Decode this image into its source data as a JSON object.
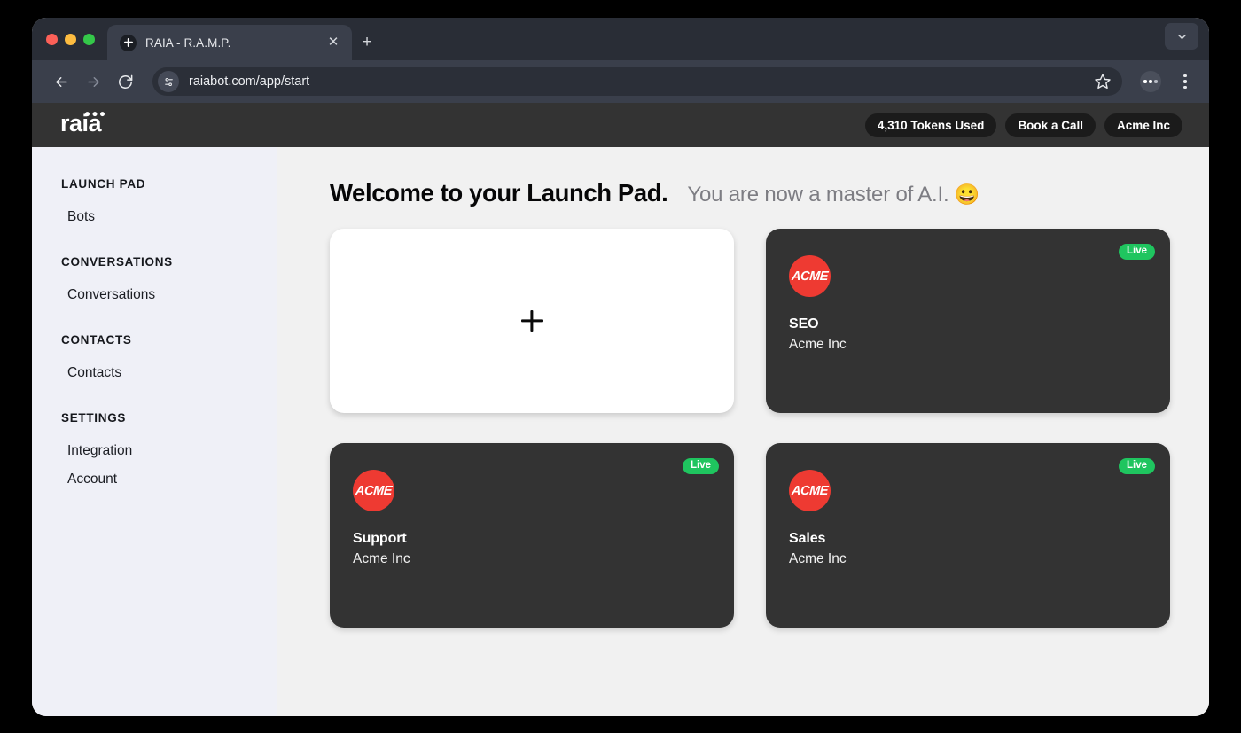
{
  "browser": {
    "tab": {
      "title": "RAIA - R.A.M.P.",
      "favicon": "plus-circle-icon",
      "close_label": "✕"
    },
    "new_tab_label": "+",
    "toolbar": {
      "back_icon": "back-arrow-icon",
      "forward_icon": "forward-arrow-icon",
      "reload_icon": "reload-icon",
      "site_settings_icon": "tune-icon",
      "url": "raiabot.com/app/start",
      "bookmark_icon": "star-icon",
      "extensions_icon": "extensions-icon",
      "menu_icon": "three-dot-menu-icon"
    },
    "tab_list_chevron": "chevron-down-icon"
  },
  "app_header": {
    "brand": "raia",
    "actions": [
      {
        "label": "4,310 Tokens Used"
      },
      {
        "label": "Book a Call"
      },
      {
        "label": "Acme Inc"
      }
    ]
  },
  "sidebar": {
    "sections": [
      {
        "title": "LAUNCH PAD",
        "items": [
          {
            "label": "Bots"
          }
        ]
      },
      {
        "title": "CONVERSATIONS",
        "items": [
          {
            "label": "Conversations"
          }
        ]
      },
      {
        "title": "CONTACTS",
        "items": [
          {
            "label": "Contacts"
          }
        ]
      },
      {
        "title": "SETTINGS",
        "items": [
          {
            "label": "Integration"
          },
          {
            "label": "Account"
          }
        ]
      }
    ]
  },
  "main": {
    "title": "Welcome to your Launch Pad.",
    "subtitle": "You are now a master of A.I.",
    "subtitle_emoji": "😀",
    "new_bot_card": {
      "glyph": "plus-icon"
    },
    "bots": [
      {
        "name": "SEO",
        "org": "Acme Inc",
        "status": "Live",
        "avatar_text": "ACME",
        "avatar_color": "#EE3A32"
      },
      {
        "name": "Support",
        "org": "Acme Inc",
        "status": "Live",
        "avatar_text": "ACME",
        "avatar_color": "#EE3A32"
      },
      {
        "name": "Sales",
        "org": "Acme Inc",
        "status": "Live",
        "avatar_text": "ACME",
        "avatar_color": "#EE3A32"
      }
    ]
  },
  "colors": {
    "accent_live": "#1FC55F",
    "brand_red": "#EE3A32",
    "card_dark": "#333333",
    "sidebar_bg": "#EFF0F7",
    "main_bg": "#F1F1F1"
  }
}
